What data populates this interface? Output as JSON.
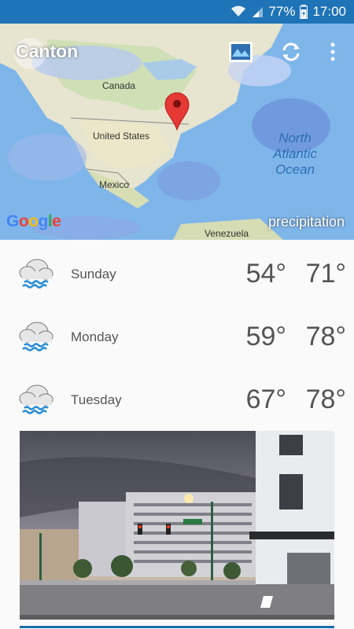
{
  "status_bar": {
    "battery_percent": "77%",
    "time": "17:00",
    "icons": [
      "wifi-icon",
      "signal-icon",
      "battery-icon"
    ]
  },
  "app_bar": {
    "title": "Canton",
    "actions": [
      "map-layer-icon",
      "refresh-icon",
      "more-vert-icon"
    ]
  },
  "map": {
    "labels": {
      "canada": "Canada",
      "united_states": "United States",
      "mexico": "Mexico",
      "venezuela": "Venezuela",
      "ocean": "North\nAtlantic\nOcean"
    },
    "google": "Google",
    "layer": "precipitation"
  },
  "forecast": [
    {
      "day": "Sunday",
      "low": "54°",
      "high": "71°",
      "icon": "rain-cloud-icon"
    },
    {
      "day": "Monday",
      "low": "59°",
      "high": "78°",
      "icon": "rain-cloud-icon"
    },
    {
      "day": "Tuesday",
      "low": "67°",
      "high": "78°",
      "icon": "rain-cloud-icon"
    }
  ],
  "colors": {
    "status_bar": "#1f73b7",
    "accent": "#1b6fa8",
    "rain_icon": "#2b8fd6"
  }
}
